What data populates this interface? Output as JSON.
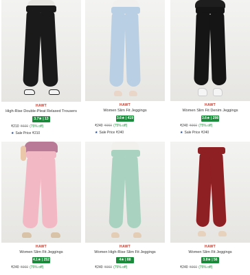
{
  "products": [
    {
      "brand": "HAWT",
      "title": "High-Rise Double-Pleat Relaxed Trousers",
      "rating": "3.7★ | 13",
      "price": "₹210",
      "mrp": "₹600",
      "off": "(75% off)",
      "sale": "Sale Price ₹210",
      "image": "black-trousers"
    },
    {
      "brand": "HAWT",
      "title": "Women Slim Fit Jeggings",
      "rating": "3.6★ | 419",
      "price": "₹240",
      "mrp": "₹960",
      "off": "(75% off)",
      "sale": "Sale Price ₹240",
      "image": "light-blue-jeggings"
    },
    {
      "brand": "HAWT",
      "title": "Women Slim Fit Denim Jeggings",
      "rating": "3.6★ | 298",
      "price": "₹240",
      "mrp": "₹960",
      "off": "(75% off)",
      "sale": "Sale Price ₹240",
      "image": "black-denim-jeggings"
    },
    {
      "brand": "HAWT",
      "title": "Women Slim Fit Jeggings",
      "rating": "4.1★ | 252",
      "price": "₹240",
      "mrp": "₹960",
      "off": "(75% off)",
      "sale": "",
      "image": "pink-jeggings"
    },
    {
      "brand": "HAWT",
      "title": "Women High-Rise Slim Fit Jeggings",
      "rating": "4★ | 88",
      "price": "₹240",
      "mrp": "₹960",
      "off": "(75% off)",
      "sale": "",
      "image": "mint-jeggings"
    },
    {
      "brand": "HAWT",
      "title": "Women Slim Fit Jeggings",
      "rating": "3.8★ | 56",
      "price": "₹240",
      "mrp": "₹960",
      "off": "(75% off)",
      "sale": "",
      "image": "maroon-jeggings"
    }
  ],
  "colors": {
    "rating_badge": "#1b8a3a",
    "brand": "#c0392b",
    "pants": [
      "#1a1a1a",
      "#b9cfe3",
      "#151515",
      "#f2b9c4",
      "#a9d2c0",
      "#8e1f23"
    ]
  }
}
